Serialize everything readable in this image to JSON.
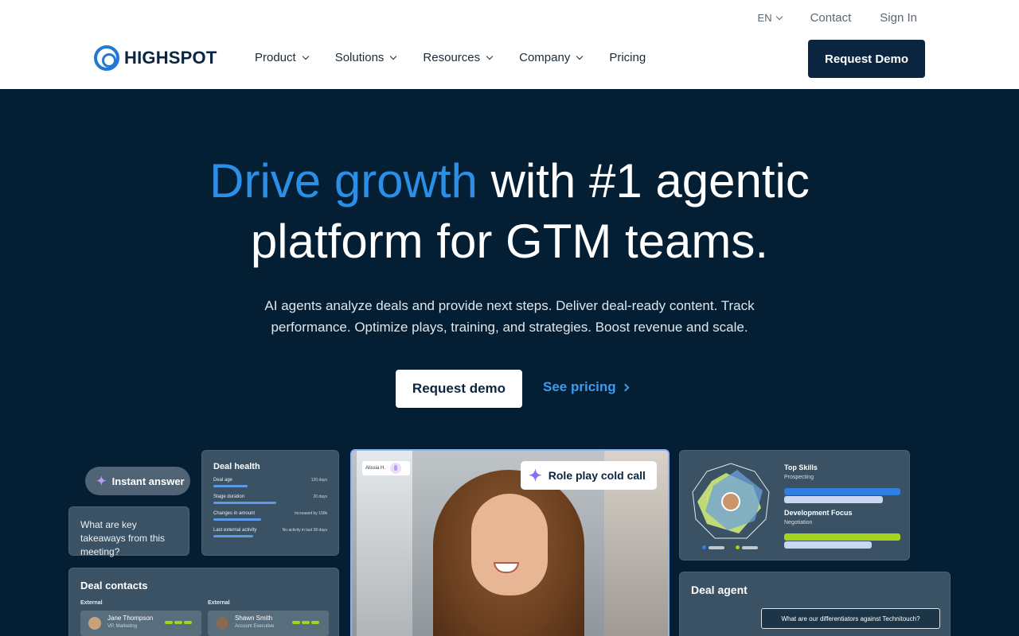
{
  "header": {
    "logo_text": "HIGHSPOT",
    "utility": {
      "language": "EN",
      "contact": "Contact",
      "sign_in": "Sign In"
    },
    "nav": [
      {
        "label": "Product",
        "dropdown": true
      },
      {
        "label": "Solutions",
        "dropdown": true
      },
      {
        "label": "Resources",
        "dropdown": true
      },
      {
        "label": "Company",
        "dropdown": true
      },
      {
        "label": "Pricing",
        "dropdown": false
      }
    ],
    "request_demo": "Request Demo"
  },
  "hero": {
    "title_accent": "Drive growth",
    "title_rest_line1": " with #1 agentic",
    "title_line2": "platform for GTM teams.",
    "subtitle": "AI agents analyze deals and provide next steps. Deliver deal-ready content. Track performance. Optimize plays, training, and strategies. Boost revenue and scale.",
    "cta_primary": "Request demo",
    "cta_secondary": "See pricing"
  },
  "cards": {
    "instant_answer": {
      "label": "Instant answer"
    },
    "question": {
      "text": "What are key takeaways from this meeting?"
    },
    "deal_health": {
      "title": "Deal health",
      "rows": [
        {
          "label": "Deal age",
          "value": "120 days",
          "fill": 0.3
        },
        {
          "label": "Stage duration",
          "value": "20 days",
          "fill": 0.55
        },
        {
          "label": "Changes in amount",
          "value": "Increased by 100k",
          "fill": 0.42
        },
        {
          "label": "Last external activity",
          "value": "No activity in last 28 days",
          "fill": 0.35
        }
      ]
    },
    "deal_contacts": {
      "title": "Deal contacts",
      "columns": [
        {
          "label": "External",
          "name": "Jane Thompson",
          "role": "VP, Marketing"
        },
        {
          "label": "External",
          "name": "Shawn Smith",
          "role": "Account Executive"
        }
      ]
    },
    "video": {
      "participant": "Alissia H.",
      "badge": "Role play cold call"
    },
    "skills": {
      "top_title": "Top Skills",
      "top_sub": "Prospecting",
      "dev_title": "Development Focus",
      "dev_sub": "Negotiation",
      "colors": {
        "blue": "#2f7fe0",
        "green": "#a6d31e",
        "light": "#c9d7f3"
      }
    },
    "deal_agent": {
      "title": "Deal agent",
      "question": "What are our differentiators against Technitouch?"
    }
  },
  "colors": {
    "brand_navy": "#0a2540",
    "accent_blue": "#2b8fe8",
    "hero_bg": "#041f33"
  }
}
